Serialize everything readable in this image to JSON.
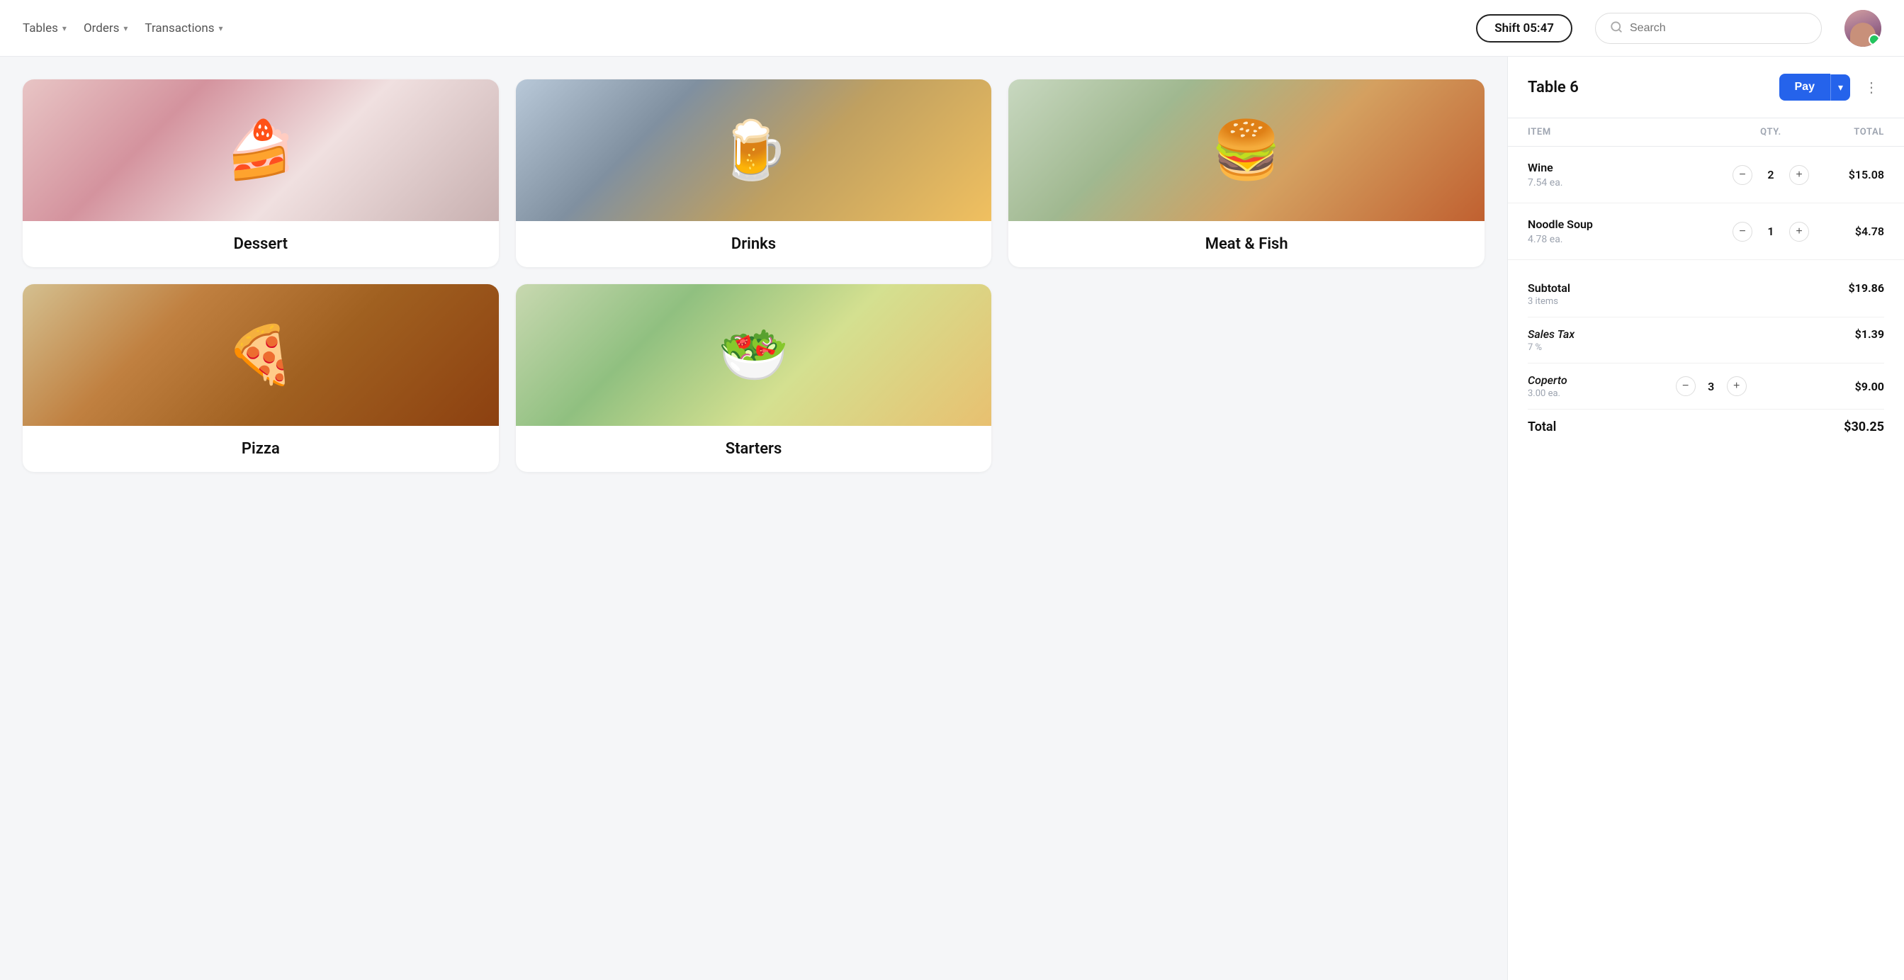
{
  "header": {
    "nav": [
      {
        "label": "Tables",
        "id": "tables"
      },
      {
        "label": "Orders",
        "id": "orders"
      },
      {
        "label": "Transactions",
        "id": "transactions"
      }
    ],
    "shift_label": "Shift 05:47",
    "search_placeholder": "Search",
    "avatar_alt": "User avatar"
  },
  "categories": [
    {
      "id": "dessert",
      "label": "Dessert",
      "img_class": "img-dessert"
    },
    {
      "id": "drinks",
      "label": "Drinks",
      "img_class": "img-drinks"
    },
    {
      "id": "meat-fish",
      "label": "Meat & Fish",
      "img_class": "img-meat"
    },
    {
      "id": "pizza",
      "label": "Pizza",
      "img_class": "img-pizza"
    },
    {
      "id": "starters",
      "label": "Starters",
      "img_class": "img-starters"
    }
  ],
  "order": {
    "table_label": "Table 6",
    "pay_label": "Pay",
    "columns": {
      "item": "ITEM",
      "qty": "QTY.",
      "total": "TOTAL"
    },
    "items": [
      {
        "name": "Wine",
        "price": "7.54 ea.",
        "qty": 2,
        "total": "$15.08"
      },
      {
        "name": "Noodle Soup",
        "price": "4.78 ea.",
        "qty": 1,
        "total": "$4.78"
      }
    ],
    "subtotal": {
      "label": "Subtotal",
      "sub": "3 items",
      "amount": "$19.86"
    },
    "tax": {
      "label": "Sales Tax",
      "sub": "7 %",
      "amount": "$1.39"
    },
    "coperto": {
      "label": "Coperto",
      "sub": "3.00 ea.",
      "qty": 3,
      "amount": "$9.00"
    },
    "total": {
      "label": "Total",
      "amount": "$30.25"
    }
  }
}
